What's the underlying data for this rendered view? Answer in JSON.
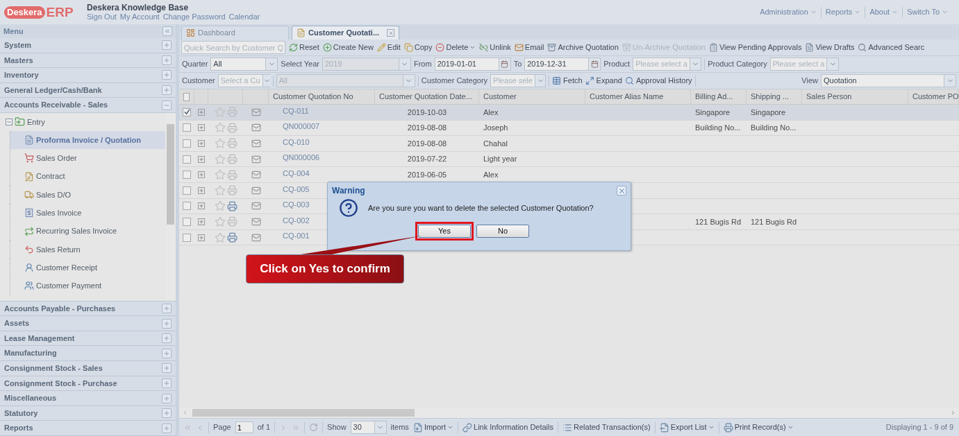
{
  "header": {
    "logo": {
      "brand": "Deskera",
      "product": "ERP"
    },
    "title": "Deskera Knowledge Base",
    "links": [
      "Sign Out",
      "My Account",
      "Change Password",
      "Calendar"
    ],
    "menus": [
      "Administration",
      "Reports",
      "About",
      "Switch To"
    ]
  },
  "sidebar": {
    "title": "Menu",
    "sections": [
      {
        "label": "System",
        "expanded": false
      },
      {
        "label": "Masters",
        "expanded": false
      },
      {
        "label": "Inventory",
        "expanded": false
      },
      {
        "label": "General Ledger/Cash/Bank",
        "expanded": false
      },
      {
        "label": "Accounts Receivable - Sales",
        "expanded": true,
        "tree": [
          {
            "label": "Entry",
            "expanded": true,
            "children": [
              {
                "label": "Proforma Invoice / Quotation",
                "selected": true
              },
              {
                "label": "Sales Order",
                "selected": false
              },
              {
                "label": "Contract",
                "selected": false
              },
              {
                "label": "Sales D/O",
                "selected": false
              },
              {
                "label": "Sales Invoice",
                "selected": false
              },
              {
                "label": "Recurring Sales Invoice",
                "selected": false
              },
              {
                "label": "Sales Return",
                "selected": false
              },
              {
                "label": "Customer Receipt",
                "selected": false
              },
              {
                "label": "Customer Payment",
                "selected": false
              }
            ]
          }
        ]
      },
      {
        "label": "Accounts Payable - Purchases",
        "expanded": false
      },
      {
        "label": "Assets",
        "expanded": false
      },
      {
        "label": "Lease Management",
        "expanded": false
      },
      {
        "label": "Manufacturing",
        "expanded": false
      },
      {
        "label": "Consignment Stock - Sales",
        "expanded": false
      },
      {
        "label": "Consignment Stock - Purchase",
        "expanded": false
      },
      {
        "label": "Miscellaneous",
        "expanded": false
      },
      {
        "label": "Statutory",
        "expanded": false
      },
      {
        "label": "Reports",
        "expanded": false
      }
    ]
  },
  "tabs": [
    {
      "label": "Dashboard",
      "selected": false,
      "closable": false
    },
    {
      "label": "Customer Quotati...",
      "selected": true,
      "closable": true
    }
  ],
  "toolbar": {
    "search_placeholder": "Quick Search by Customer Q",
    "buttons": [
      {
        "label": "Reset",
        "disabled": false,
        "dropdown": false
      },
      {
        "label": "Create New",
        "disabled": false,
        "dropdown": false
      },
      {
        "label": "Edit",
        "disabled": false,
        "dropdown": false
      },
      {
        "label": "Copy",
        "disabled": false,
        "dropdown": false
      },
      {
        "label": "Delete",
        "disabled": false,
        "dropdown": true
      },
      {
        "label": "Unlink",
        "disabled": false,
        "dropdown": false
      },
      {
        "label": "Email",
        "disabled": false,
        "dropdown": false
      },
      {
        "label": "Archive Quotation",
        "disabled": false,
        "dropdown": false
      },
      {
        "label": "Un-Archive Quotation",
        "disabled": true,
        "dropdown": false
      },
      {
        "label": "View Pending Approvals",
        "disabled": false,
        "dropdown": false
      },
      {
        "label": "View Drafts",
        "disabled": false,
        "dropdown": false
      },
      {
        "label": "Advanced Searc",
        "disabled": false,
        "dropdown": false
      }
    ]
  },
  "filters": {
    "quarter": {
      "label": "Quarter",
      "value": "All"
    },
    "year": {
      "label": "Select Year",
      "value": "2019",
      "disabled": true
    },
    "from": {
      "label": "From",
      "value": "2019-01-01"
    },
    "to": {
      "label": "To",
      "value": "2019-12-31"
    },
    "product": {
      "label": "Product",
      "placeholder": "Please select a"
    },
    "product_category": {
      "label": "Product Category",
      "placeholder": "Please select a"
    },
    "customer": {
      "label": "Customer",
      "placeholder": "Select a Cu"
    },
    "customer_scope": {
      "value": "All",
      "disabled": true
    },
    "customer_category": {
      "label": "Customer Category",
      "placeholder": "Please sele"
    },
    "actions": [
      "Fetch",
      "Expand",
      "Approval History"
    ],
    "view": {
      "label": "View",
      "value": "Quotation"
    }
  },
  "grid": {
    "all_selected": false,
    "columns": [
      "Customer Quotation No",
      "Customer Quotation Date...",
      "Customer",
      "Customer Alias Name",
      "Billing Ad...",
      "Shipping ...",
      "Sales Person",
      "Customer PO"
    ],
    "rows": [
      {
        "selected": true,
        "starred": false,
        "printed": false,
        "no": "CQ-011",
        "date": "2019-10-03",
        "customer": "Alex",
        "billing_address": "Singapore",
        "shipping_address": "Singapore"
      },
      {
        "selected": false,
        "starred": false,
        "printed": false,
        "no": "QN000007",
        "date": "2019-08-08",
        "customer": "Joseph",
        "billing_address": "Building No...",
        "shipping_address": "Building No..."
      },
      {
        "selected": false,
        "starred": false,
        "printed": false,
        "no": "CQ-010",
        "date": "2019-08-08",
        "customer": "Chahal"
      },
      {
        "selected": false,
        "starred": false,
        "printed": false,
        "no": "QN000006",
        "date": "2019-07-22",
        "customer": "Light year"
      },
      {
        "selected": false,
        "starred": false,
        "printed": false,
        "no": "CQ-004",
        "date": "2019-06-05",
        "customer": "Alex"
      },
      {
        "selected": false,
        "starred": false,
        "printed": false,
        "no": "CQ-005"
      },
      {
        "selected": false,
        "starred": false,
        "printed": true,
        "no": "CQ-003"
      },
      {
        "selected": false,
        "starred": false,
        "printed": false,
        "no": "CQ-002",
        "billing_address": "121 Bugis Rd",
        "shipping_address": "121 Bugis Rd"
      },
      {
        "selected": false,
        "starred": false,
        "printed": true,
        "no": "CQ-001"
      }
    ]
  },
  "paging": {
    "page_label": "Page",
    "page": "1",
    "of": "of 1",
    "show_label": "Show",
    "page_size": "30",
    "items_label": "items",
    "actions": [
      {
        "label": "Import",
        "dropdown": true
      },
      {
        "label": "Link Information Details",
        "dropdown": false
      },
      {
        "label": "Related Transaction(s)",
        "dropdown": false
      },
      {
        "label": "Export List",
        "dropdown": true
      },
      {
        "label": "Print Record(s)",
        "dropdown": true
      }
    ],
    "summary": "Displaying 1 - 9 of 9"
  },
  "dialog": {
    "title": "Warning",
    "message": "Are you sure you want to delete the selected Customer Quotation?",
    "buttons": [
      {
        "label": "Yes",
        "highlighted": true
      },
      {
        "label": "No",
        "highlighted": false
      }
    ]
  },
  "annotation": {
    "text": "Click on Yes to confirm"
  }
}
